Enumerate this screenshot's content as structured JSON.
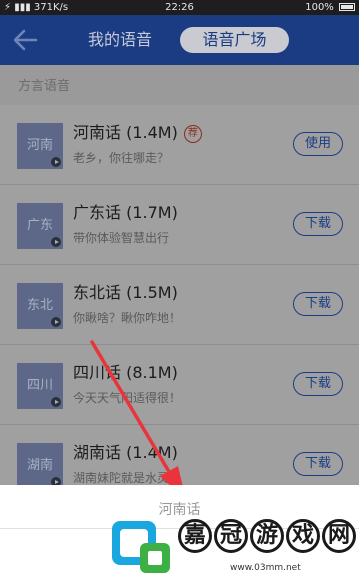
{
  "status_bar": {
    "carrier_signal": "⚡ ▮▮▮",
    "network_speed": "371K/s",
    "time": "22:26",
    "battery": "100%"
  },
  "nav": {
    "back_icon": "back-arrow-icon",
    "tab_mine": "我的语音",
    "tab_plaza": "语音广场"
  },
  "section": {
    "title": "方言语音"
  },
  "items": [
    {
      "thumb": "河南",
      "name": "河南话 (1.4M)",
      "badge": "荐",
      "desc": "老乡，你往哪走？",
      "action": "使用"
    },
    {
      "thumb": "广东",
      "name": "广东话 (1.7M)",
      "badge": "",
      "desc": "带你体验智慧出行",
      "action": "下载"
    },
    {
      "thumb": "东北",
      "name": "东北话 (1.5M)",
      "badge": "",
      "desc": "你瞅啥？瞅你咋地！",
      "action": "下载"
    },
    {
      "thumb": "四川",
      "name": "四川话 (8.1M)",
      "badge": "",
      "desc": "今天天气阳适得很！",
      "action": "下载"
    },
    {
      "thumb": "湖南",
      "name": "湖南话 (1.4M)",
      "badge": "",
      "desc": "湖南妹陀就是水灵",
      "action": "下载"
    }
  ],
  "sheet": {
    "title": "河南话"
  },
  "watermark": {
    "chars": [
      "嘉",
      "冠",
      "游",
      "戏",
      "网"
    ],
    "url": "www.03mm.net"
  },
  "colors": {
    "nav_bg": "#1b3c83",
    "accent": "#1b3c83",
    "overlay_bg": "#9c9c9c",
    "arrow": "#e8343a"
  }
}
